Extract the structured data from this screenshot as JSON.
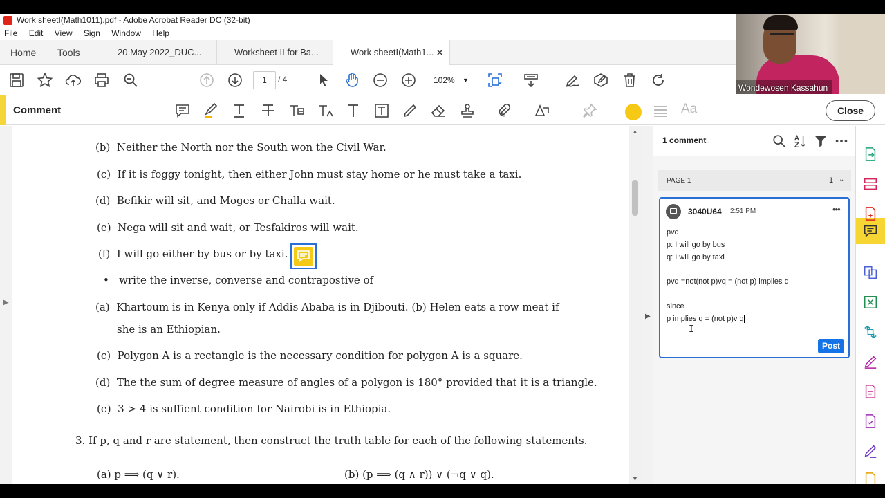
{
  "window": {
    "title": "Work sheetI(Math1011).pdf - Adobe Acrobat Reader DC (32-bit)"
  },
  "menu": [
    "File",
    "Edit",
    "View",
    "Sign",
    "Window",
    "Help"
  ],
  "tabs": {
    "home": "Home",
    "tools": "Tools",
    "documents": [
      {
        "label": "20 May 2022_DUC..."
      },
      {
        "label": "Worksheet II for Ba..."
      },
      {
        "label": "Work sheetI(Math1...",
        "close": "✕"
      }
    ]
  },
  "toolbar": {
    "page_current": "1",
    "page_total": "/ 4",
    "zoom": "102%"
  },
  "comment_bar": {
    "title": "Comment",
    "close_label": "Close",
    "font_glyph": "Aa",
    "accent_color": "#f4d63b",
    "highlight_color": "#f6c915"
  },
  "document": {
    "lines": [
      {
        "label": "(b)",
        "text": "Neither the North nor the South won the Civil War."
      },
      {
        "label": "(c)",
        "text": "If it is foggy tonight, then either John must stay home or he must take a taxi."
      },
      {
        "label": "(d)",
        "text": "Befikir will sit, and Moges or Challa wait."
      },
      {
        "label": "(e)",
        "text": "Nega will sit and wait, or Tesfakiros will wait."
      },
      {
        "label": "(f)",
        "text": "I will go either by bus or by taxi."
      },
      {
        "label": "•",
        "text": "write the inverse, converse and contrapostive of"
      },
      {
        "label": "(a)",
        "text": "Khartoum is in Kenya only if Addis Ababa is in Djibouti.   (b) Helen eats a row meat if"
      },
      {
        "label": "",
        "text": "she is an Ethiopian."
      },
      {
        "label": "(c)",
        "text": "Polygon A is a rectangle is the necessary condition for polygon A is a square."
      },
      {
        "label": "(d)",
        "text": "The the sum of degree measure of angles of a polygon is 180° provided that it is a triangle."
      },
      {
        "label": "(e)",
        "text": "3 > 4 is suffient condition for Nairobi is in Ethiopia."
      }
    ],
    "question3": "3.  If p, q and r are statement, then construct the truth table for each of the following statements.",
    "q3a": "(a)  p  ⟹  (q ∨ r).",
    "q3b": "(b)  (p  ⟹  (q ∧ r)) ∨ (¬q ∨ q)."
  },
  "comments_panel": {
    "count_label": "1 comment",
    "page_label": "PAGE 1",
    "page_count": "1",
    "comment": {
      "author": "3040U64",
      "time": "2:51 PM",
      "lines": [
        "pvq",
        "p: I will go by bus",
        "q: I will go by taxi",
        "",
        "pvq =not(not p)vq = (not p) implies q",
        "",
        "since",
        "p implies q = (not p)v q"
      ],
      "post_label": "Post"
    }
  },
  "webcam": {
    "name": "Wondewosen Kassahun"
  }
}
